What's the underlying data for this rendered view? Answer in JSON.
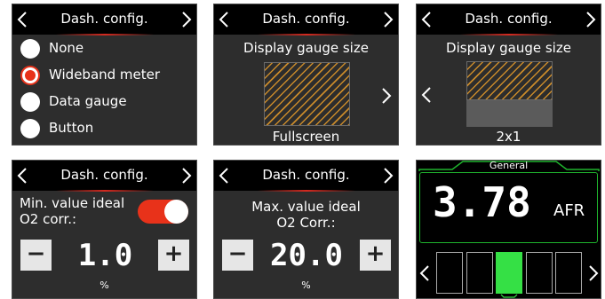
{
  "header_title": "Dash. config.",
  "screen1": {
    "options": [
      {
        "label": "None",
        "selected": false
      },
      {
        "label": "Wideband meter",
        "selected": true
      },
      {
        "label": "Data gauge",
        "selected": false
      },
      {
        "label": "Button",
        "selected": false
      }
    ]
  },
  "screen2": {
    "subtitle": "Display gauge size",
    "size_label": "Fullscreen"
  },
  "screen3": {
    "subtitle": "Display gauge size",
    "size_label": "2x1"
  },
  "screen4": {
    "label_line1": "Min. value ideal",
    "label_line2": "O2 corr.:",
    "toggle_on": true,
    "minus_label": "−",
    "plus_label": "+",
    "value": "1.0",
    "unit": "%"
  },
  "screen5": {
    "label_line1": "Max. value ideal",
    "label_line2": "O2 Corr.:",
    "minus_label": "−",
    "plus_label": "+",
    "value": "20.0",
    "unit": "%"
  },
  "screen6": {
    "title": "General",
    "value": "3.78",
    "unit": "AFR",
    "segments_total": 5,
    "segment_active": 3
  },
  "colors": {
    "accent_red": "#e8321a",
    "gauge_green": "#35e045",
    "hatch": "#c98a2a",
    "panel": "#2d2d2d"
  }
}
